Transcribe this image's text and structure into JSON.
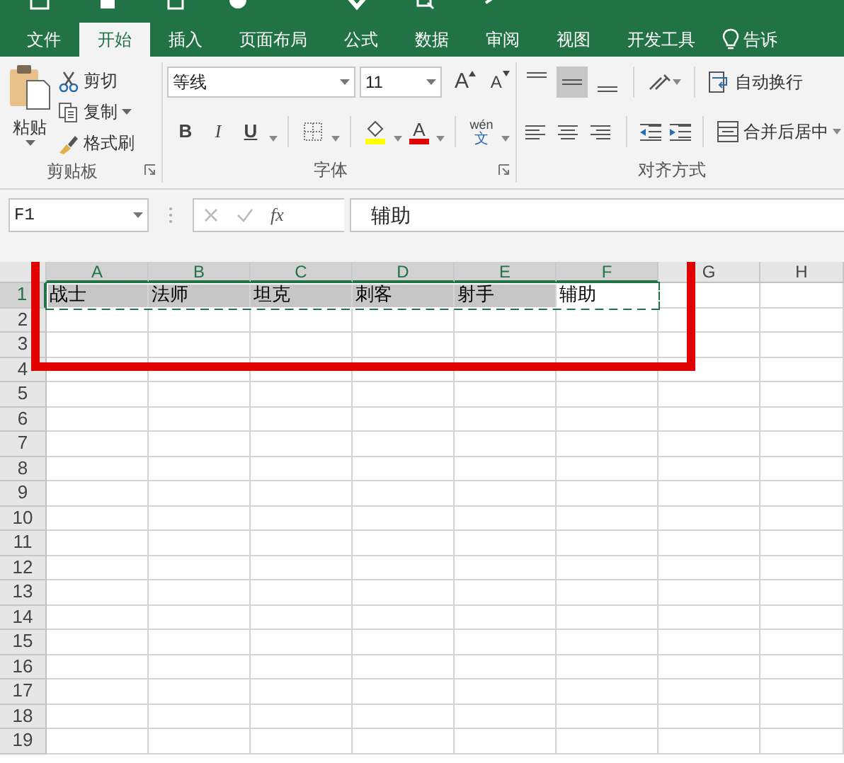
{
  "ribbon": {
    "tabs": [
      {
        "label": "文件",
        "selected": false
      },
      {
        "label": "开始",
        "selected": true
      },
      {
        "label": "插入",
        "selected": false
      },
      {
        "label": "页面布局",
        "selected": false
      },
      {
        "label": "公式",
        "selected": false
      },
      {
        "label": "数据",
        "selected": false
      },
      {
        "label": "审阅",
        "selected": false
      },
      {
        "label": "视图",
        "selected": false
      },
      {
        "label": "开发工具",
        "selected": false
      }
    ],
    "tell_me": "告诉",
    "clipboard_group": {
      "title": "剪贴板",
      "paste": "粘贴",
      "commands": [
        "剪切",
        "复制",
        "格式刷"
      ]
    },
    "font_group": {
      "title": "字体",
      "font_name": "等线",
      "font_size": "11",
      "grow_font": "A",
      "shrink_font": "A",
      "bold": "B",
      "italic": "I",
      "underline": "U",
      "font_color": "A",
      "phonetic_top": "wén",
      "phonetic_bottom": "文"
    },
    "alignment_group": {
      "title": "对齐方式",
      "vertical_align": [
        {
          "selected": false
        },
        {
          "selected": true
        },
        {
          "selected": false
        }
      ],
      "horizontal_align": [
        {
          "selected": false
        },
        {
          "selected": false
        },
        {
          "selected": false
        }
      ],
      "wrap_text": "自动换行",
      "merge_center": "合并后居中"
    }
  },
  "formula_bar": {
    "name_box": "F1",
    "fx": "fx",
    "formula": "辅助"
  },
  "sheet": {
    "columns": [
      {
        "label": "A",
        "selected": true
      },
      {
        "label": "B",
        "selected": true
      },
      {
        "label": "C",
        "selected": true
      },
      {
        "label": "D",
        "selected": true
      },
      {
        "label": "E",
        "selected": true
      },
      {
        "label": "F",
        "selected": true
      },
      {
        "label": "G",
        "selected": false
      },
      {
        "label": "H",
        "selected": false
      }
    ],
    "rows": [
      {
        "label": "1",
        "selected": true,
        "cells": [
          {
            "text": "战士",
            "active": false
          },
          {
            "text": "法师",
            "active": false
          },
          {
            "text": "坦克",
            "active": false
          },
          {
            "text": "刺客",
            "active": false
          },
          {
            "text": "射手",
            "active": false
          },
          {
            "text": "辅助",
            "active": true
          }
        ]
      },
      {
        "label": "2",
        "selected": false
      },
      {
        "label": "3",
        "selected": false
      },
      {
        "label": "4",
        "selected": false
      },
      {
        "label": "5",
        "selected": false
      },
      {
        "label": "6",
        "selected": false
      },
      {
        "label": "7",
        "selected": false
      },
      {
        "label": "8",
        "selected": false
      },
      {
        "label": "9",
        "selected": false
      },
      {
        "label": "10",
        "selected": false
      },
      {
        "label": "11",
        "selected": false
      },
      {
        "label": "12",
        "selected": false
      },
      {
        "label": "13",
        "selected": false
      },
      {
        "label": "14",
        "selected": false
      },
      {
        "label": "15",
        "selected": false
      },
      {
        "label": "16",
        "selected": false
      },
      {
        "label": "17",
        "selected": false
      },
      {
        "label": "18",
        "selected": false
      },
      {
        "label": "19",
        "selected": false
      }
    ],
    "copy_marquee": true,
    "annotation": {
      "kind": "rectangle"
    }
  }
}
